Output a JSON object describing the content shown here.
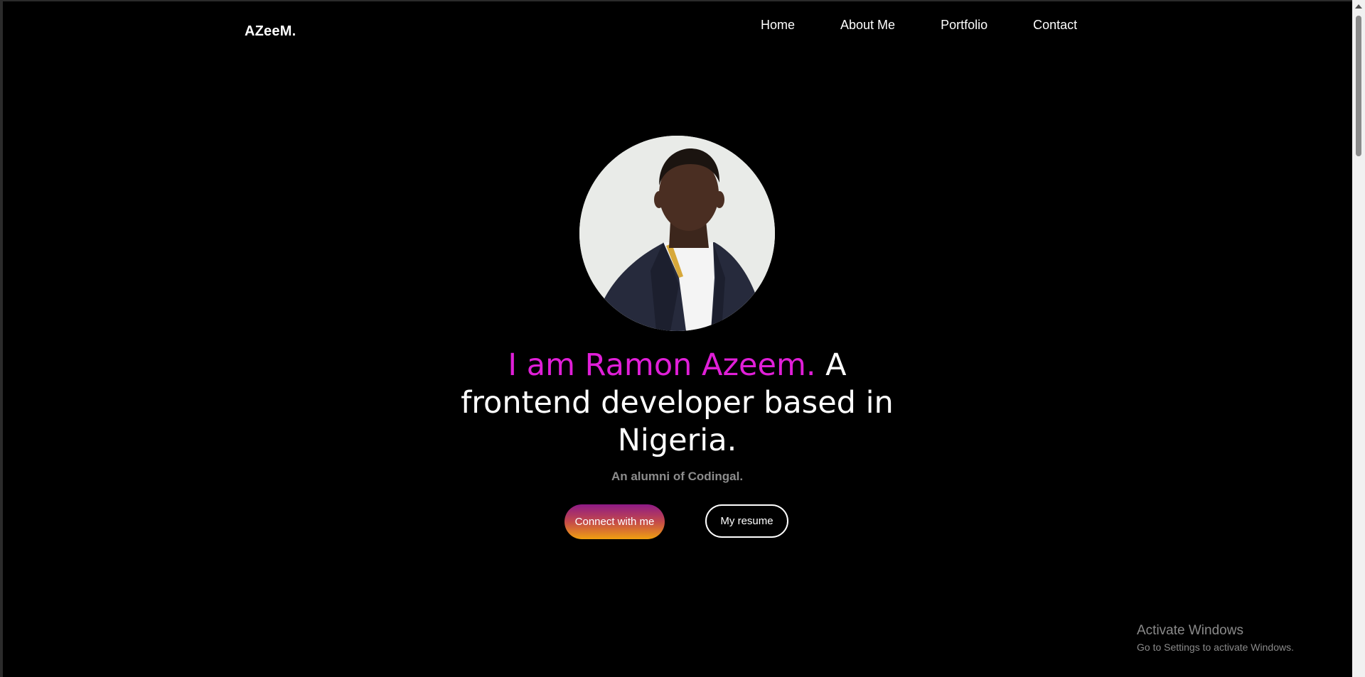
{
  "navbar": {
    "logo": "AZeeM.",
    "links": [
      "Home",
      "About Me",
      "Portfolio",
      "Contact"
    ]
  },
  "hero": {
    "headline_accent": "I am Ramon Azeem.",
    "headline_rest": " A frontend developer based in Nigeria.",
    "subtext": "An alumni of Codingal.",
    "primary_button": "Connect with me",
    "secondary_button": "My resume"
  },
  "watermark": {
    "title": "Activate Windows",
    "subtitle": "Go to Settings to activate Windows."
  },
  "colors": {
    "background": "#000000",
    "accent": "#e01fd8",
    "subtext": "#8c8c8c"
  }
}
